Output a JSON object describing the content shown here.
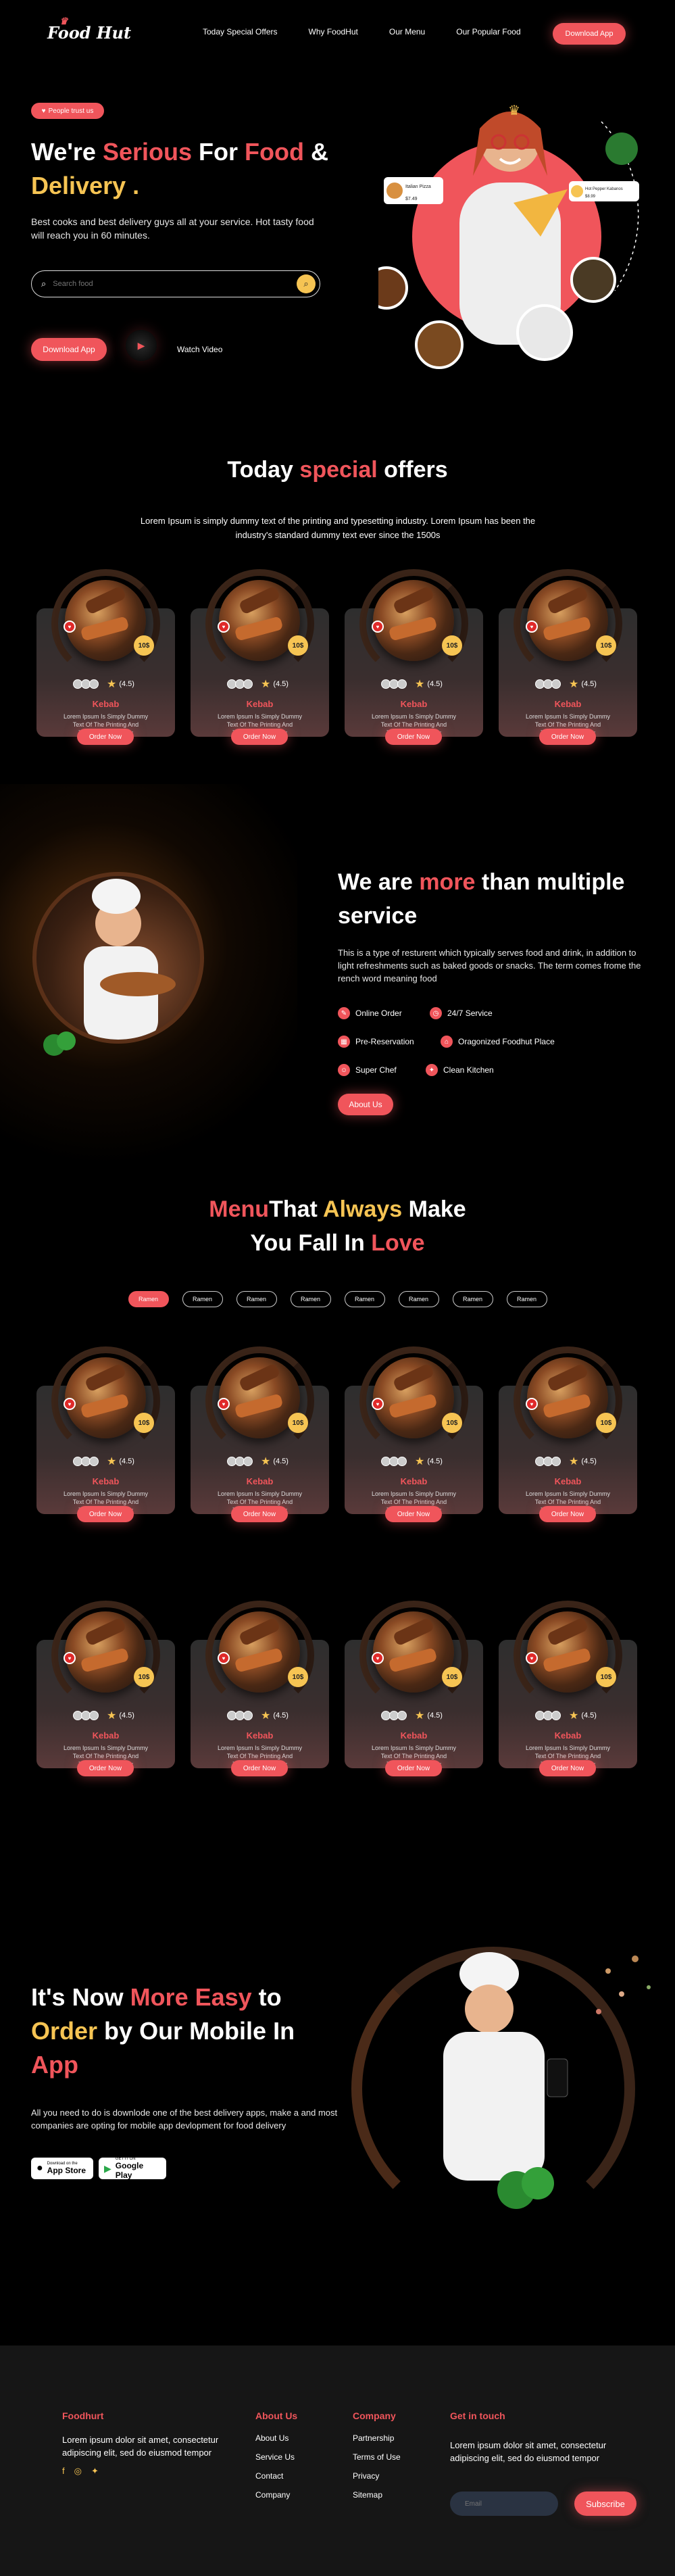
{
  "brand": {
    "logo": "Food Hut",
    "accent": "#f0555b",
    "gold": "#f6c453"
  },
  "nav": {
    "items": [
      "Today Special Offers",
      "Why FoodHut",
      "Our Menu",
      "Our Popular Food"
    ],
    "cta": "Download App"
  },
  "hero": {
    "badge": "People trust us",
    "title_a": "We're ",
    "title_b": "Serious",
    "title_c": " For ",
    "title_d": "Food",
    "title_e": " &",
    "title_f": "Delivery",
    "title_g": " .",
    "description": "Best cooks and best delivery guys all at your service. Hot tasty food will reach you in 60 minutes.",
    "search_placeholder": "Search food",
    "download": "Download App",
    "watch": "Watch Video",
    "float_card_1": {
      "name": "Italian Pizza",
      "price": "$7.49"
    },
    "float_card_2": {
      "name": "Hot Pepper Kabanos",
      "price": "$8.99"
    }
  },
  "offers": {
    "title_a": "Today ",
    "title_b": "special",
    "title_c": " offers",
    "description": "Lorem Ipsum is simply dummy text of the printing and typesetting industry. Lorem Ipsum has been the industry's standard dummy text ever since the 1500s"
  },
  "card": {
    "name": "Kebab",
    "price": "10$",
    "rating": "(4.5)",
    "desc": "Lorem Ipsum Is Simply Dummy Text Of The Printing And Typesetting Industry",
    "order": "Order Now"
  },
  "service": {
    "title_a": "We are ",
    "title_b": "more",
    "title_c": " than multiple service",
    "description": "This is a type of resturent which typically serves food and drink, in addition to light refreshments such as baked goods or snacks. The term comes frome the rench word meaning food",
    "features": [
      "Online Order",
      "24/7 Service",
      "Pre-Reservation",
      "Oragonized Foodhut Place",
      "Super Chef",
      "Clean Kitchen"
    ],
    "cta": "About Us"
  },
  "menu": {
    "title_a": "Menu",
    "title_b": "That ",
    "title_c": "Always",
    "title_d": " Make",
    "title_e": "You Fall In ",
    "title_f": "Love",
    "tabs": [
      "Ramen",
      "Ramen",
      "Ramen",
      "Ramen",
      "Ramen",
      "Ramen",
      "Ramen",
      "Ramen"
    ]
  },
  "app": {
    "title_a": "It's Now ",
    "title_b": "More Easy",
    "title_c": " to",
    "title_d": "Order",
    "title_e": " by Our Mobile In",
    "title_f": "App",
    "description": "All you need to do is downlode one of the best delivery apps, make a and most companies are opting for mobile app devlopment for food delivery",
    "appstore_small": "Download on the",
    "appstore_big": "App Store",
    "play_small": "GET IT ON",
    "play_big": "Google Play"
  },
  "footer": {
    "brand": "Foodhurt",
    "brand_text": "Lorem ipsum dolor sit amet, consectetur adipiscing elit, sed do eiusmod tempor",
    "about_title": "About Us",
    "about": [
      "About Us",
      "Service Us",
      "Contact",
      "Company"
    ],
    "company_title": "Company",
    "company": [
      "Partnership",
      "Terms of Use",
      "Privacy",
      "Sitemap"
    ],
    "touch_title": "Get in touch",
    "touch_text": "Lorem ipsum dolor sit amet, consectetur adipiscing elit, sed do eiusmod tempor",
    "email_placeholder": "Email",
    "subscribe": "Subscribe"
  }
}
